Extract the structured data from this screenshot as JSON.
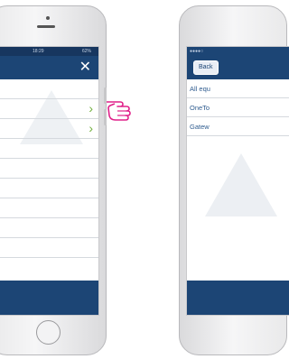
{
  "left_phone": {
    "status_bar": {
      "time": "18:29",
      "battery": "62%"
    },
    "close_icon": "close-icon",
    "rows": [
      {
        "has_chevron": false
      },
      {
        "has_chevron": true
      },
      {
        "has_chevron": true
      },
      {
        "has_chevron": false
      },
      {
        "has_chevron": false
      },
      {
        "has_chevron": false
      },
      {
        "has_chevron": false
      },
      {
        "has_chevron": false
      },
      {
        "has_chevron": false
      }
    ],
    "chevron_glyph": "›",
    "accent_color": "#1c4575",
    "chevron_color": "#6fae3a"
  },
  "pointer": {
    "icon": "pointing-hand-icon",
    "color": "#e0218a"
  },
  "right_phone": {
    "status_bar": {
      "carrier": "●●●●○"
    },
    "back_label": "Back",
    "rows": [
      "All equ",
      "OneTo",
      "Gatew"
    ],
    "accent_color": "#1c4575"
  }
}
